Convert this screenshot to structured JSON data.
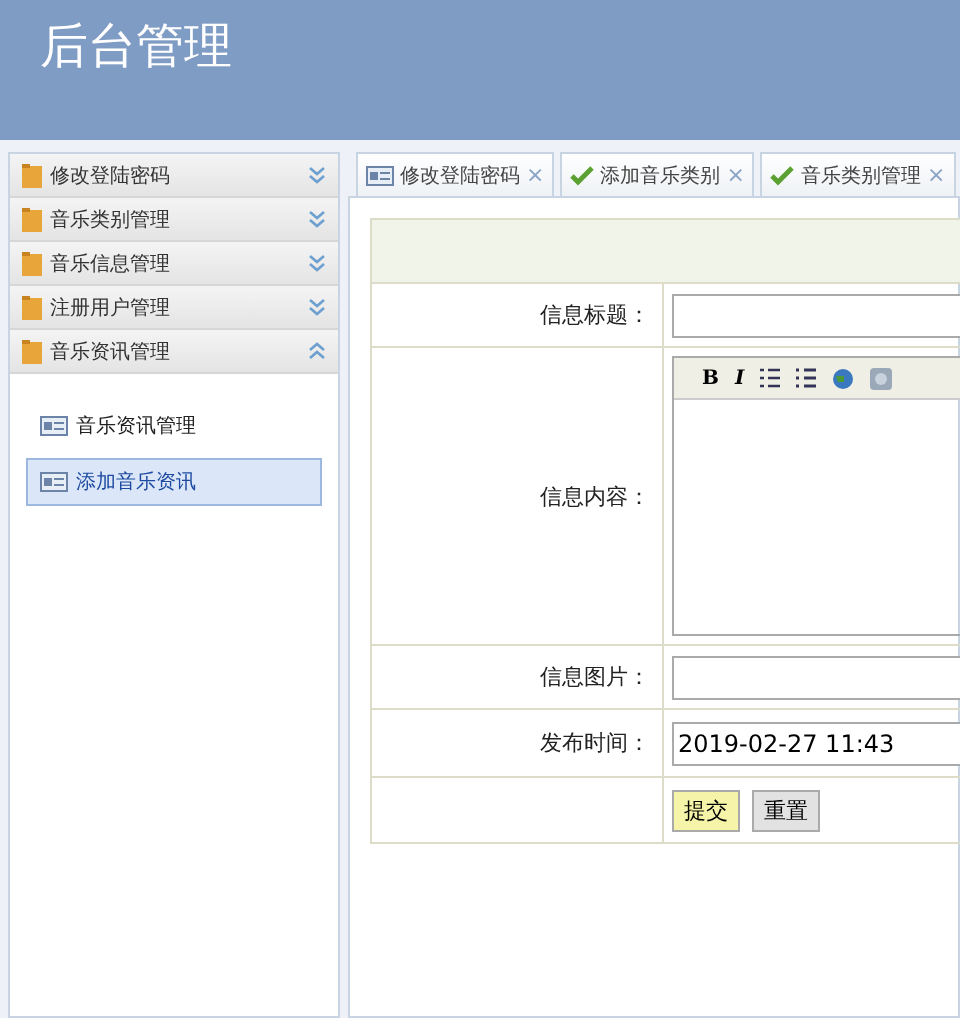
{
  "header": {
    "title": "后台管理"
  },
  "sidebar": {
    "sections": [
      {
        "label": "修改登陆密码",
        "expanded": false
      },
      {
        "label": "音乐类别管理",
        "expanded": false
      },
      {
        "label": "音乐信息管理",
        "expanded": false
      },
      {
        "label": "注册用户管理",
        "expanded": false
      },
      {
        "label": "音乐资讯管理",
        "expanded": true,
        "children": [
          {
            "label": "音乐资讯管理",
            "selected": false
          },
          {
            "label": "添加音乐资讯",
            "selected": true
          }
        ]
      }
    ]
  },
  "tabs": [
    {
      "label": "修改登陆密码",
      "kind": "card",
      "close": "×"
    },
    {
      "label": "添加音乐类别",
      "kind": "check",
      "close": "×"
    },
    {
      "label": "音乐类别管理",
      "kind": "check",
      "close": "×"
    }
  ],
  "form": {
    "rows": [
      {
        "label": "信息标题：",
        "kind": "text",
        "value": ""
      },
      {
        "label": "信息内容：",
        "kind": "editor",
        "toolbar": [
          {
            "kind": "text",
            "label": "B"
          },
          {
            "kind": "text",
            "label": "I"
          },
          {
            "kind": "ol"
          },
          {
            "kind": "ul"
          },
          {
            "kind": "globe"
          },
          {
            "kind": "image"
          }
        ]
      },
      {
        "label": "信息图片：",
        "kind": "text",
        "value": ""
      },
      {
        "label": "发布时间：",
        "kind": "text",
        "value": "2019-02-27 11:43"
      }
    ],
    "buttons": [
      {
        "label": "提交",
        "kind": "primary"
      },
      {
        "label": "重置",
        "kind": "secondary"
      }
    ]
  }
}
